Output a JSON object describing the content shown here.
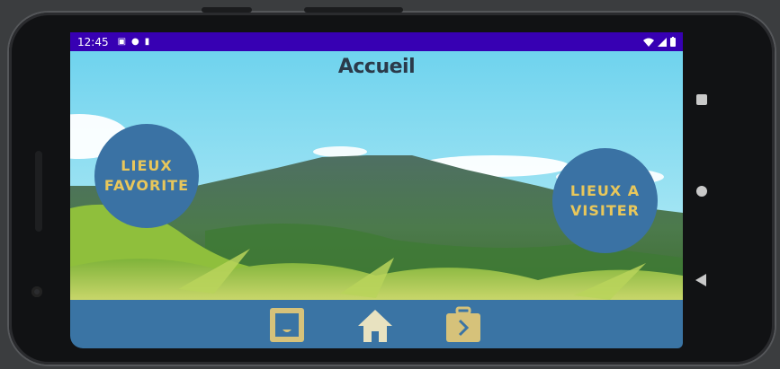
{
  "status_bar": {
    "time": "12:45",
    "left_icons": [
      "a-icon",
      "p-icon",
      "sd-card-icon"
    ],
    "right_icons": [
      "wifi-icon",
      "signal-icon",
      "battery-icon"
    ]
  },
  "page": {
    "title": "Accueil"
  },
  "buttons": {
    "favorites_line1": "LIEUX",
    "favorites_line2": "FAVORITE",
    "to_visit_line1": "LIEUX A",
    "to_visit_line2": "VISITER"
  },
  "bottom_nav": {
    "items": [
      "inbox-icon",
      "home-icon",
      "briefcase-arrow-icon"
    ],
    "icon_color": "#d6c27a",
    "background": "#3a74a4"
  },
  "colors": {
    "status_bar": "#3700b3",
    "circle_button": "#3a72a4",
    "circle_text": "#e8c75b"
  }
}
